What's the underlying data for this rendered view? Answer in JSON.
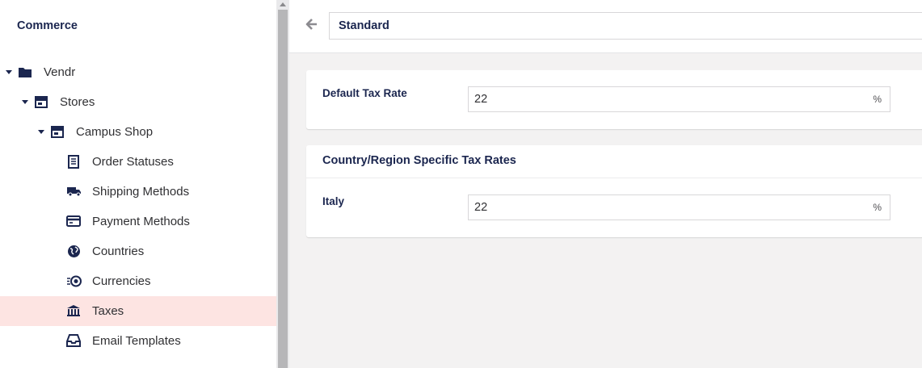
{
  "sidebar": {
    "title": "Commerce",
    "tree": [
      {
        "label": "Vendr",
        "icon": "folder-icon"
      },
      {
        "label": "Stores",
        "icon": "store-icon"
      },
      {
        "label": "Campus Shop",
        "icon": "store-icon"
      },
      {
        "label": "Order Statuses",
        "icon": "receipt-icon"
      },
      {
        "label": "Shipping Methods",
        "icon": "truck-icon"
      },
      {
        "label": "Payment Methods",
        "icon": "credit-card-icon"
      },
      {
        "label": "Countries",
        "icon": "globe-icon"
      },
      {
        "label": "Currencies",
        "icon": "coins-icon"
      },
      {
        "label": "Taxes",
        "icon": "bank-icon"
      },
      {
        "label": "Email Templates",
        "icon": "inbox-icon"
      }
    ],
    "active_item": "Taxes"
  },
  "header": {
    "name_value": "Standard"
  },
  "default_tax": {
    "label": "Default Tax Rate",
    "value": "22",
    "suffix": "%"
  },
  "country_rates": {
    "title": "Country/Region Specific Tax Rates",
    "rows": [
      {
        "label": "Italy",
        "value": "22",
        "suffix": "%"
      }
    ]
  },
  "colors": {
    "active_bg": "#fde4e2",
    "navy": "#1b264f"
  }
}
